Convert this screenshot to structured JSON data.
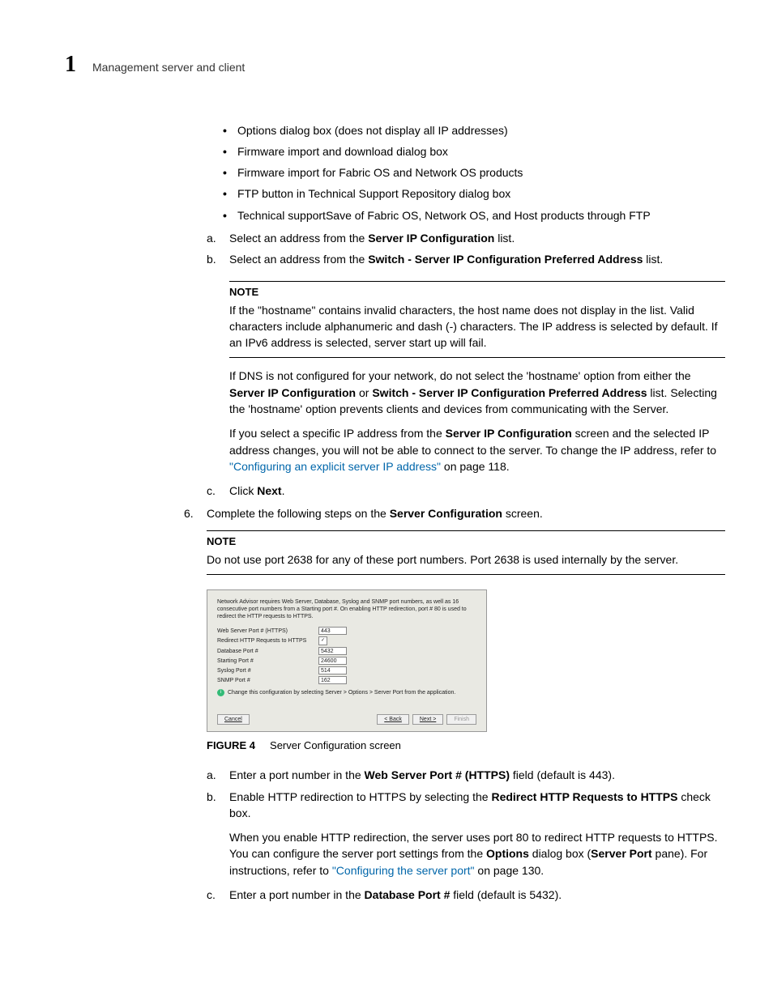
{
  "header": {
    "chapterNumber": "1",
    "chapterTitle": "Management server and client"
  },
  "bullets": [
    "Options dialog box (does not display all IP addresses)",
    "Firmware import and download dialog box",
    "Firmware import for Fabric OS and Network OS products",
    "FTP button in Technical Support Repository dialog box",
    "Technical supportSave of Fabric OS, Network OS, and Host products through FTP"
  ],
  "steps": {
    "a": {
      "pre": "Select an address from the ",
      "bold": "Server IP Configuration",
      "post": " list."
    },
    "b": {
      "pre": "Select an address from the ",
      "bold": "Switch - Server IP Configuration Preferred Address",
      "post": " list."
    },
    "c": {
      "pre": "Click ",
      "bold": "Next",
      "post": "."
    }
  },
  "note1": {
    "label": "NOTE",
    "text": "If the \"hostname\" contains invalid characters, the host name does not display in the list. Valid characters include alphanumeric and dash (-) characters. The IP address is selected by default. If an IPv6 address is selected, server start up will fail."
  },
  "dnsPara": {
    "pre": "If DNS is not configured for your network, do not select the 'hostname' option from either the ",
    "b1": "Server IP Configuration",
    "mid": " or ",
    "b2": "Switch - Server IP Configuration Preferred Address",
    "post": " list. Selecting the 'hostname' option prevents clients and devices from communicating with the Server."
  },
  "ipPara": {
    "pre": "If you select a specific IP address from the ",
    "b1": "Server IP Configuration",
    "mid": " screen and the selected IP address changes, you will not be able to connect to the server. To change the IP address, refer to ",
    "link": "\"Configuring an explicit server IP address\"",
    "post": " on page 118."
  },
  "step6": {
    "pre": "Complete the following steps on the ",
    "bold": "Server Configuration",
    "post": " screen."
  },
  "note2": {
    "label": "NOTE",
    "text": "Do not use port 2638 for any of these port numbers. Port 2638 is used internally by the server."
  },
  "figure": {
    "desc": "Network Advisor requires Web Server, Database, Syslog and SNMP port numbers, as well as 16 consecutive port numbers from a Starting port #. On enabling HTTP redirection, port # 80 is used to redirect the HTTP requests to HTTPS.",
    "rows": {
      "webServer": {
        "label": "Web Server Port # (HTTPS)",
        "value": "443"
      },
      "redirect": {
        "label": "Redirect HTTP Requests to HTTPS",
        "checked": "✓"
      },
      "db": {
        "label": "Database Port #",
        "value": "5432"
      },
      "starting": {
        "label": "Starting Port #",
        "value": "24600"
      },
      "syslog": {
        "label": "Syslog Port #",
        "value": "514"
      },
      "snmp": {
        "label": "SNMP Port #",
        "value": "162"
      }
    },
    "info": "Change this configuration by selecting Server > Options > Server Port from the application.",
    "buttons": {
      "cancel": "Cancel",
      "back": "< Back",
      "next": "Next >",
      "finish": "Finish"
    },
    "captionLabel": "FIGURE 4",
    "captionText": "Server Configuration screen"
  },
  "subSteps": {
    "a": {
      "pre": "Enter a port number in the ",
      "bold": "Web Server Port # (HTTPS)",
      "post": " field (default is 443)."
    },
    "b": {
      "pre": "Enable HTTP redirection to HTTPS by selecting the ",
      "bold": "Redirect HTTP Requests to HTTPS",
      "post": " check box."
    },
    "bPara": {
      "pre": "When you enable HTTP redirection, the server uses port 80 to redirect HTTP requests to HTTPS. You can configure the server port settings from the ",
      "b1": "Options",
      "mid": " dialog box (",
      "b2": "Server Port",
      "post1": " pane). For instructions, refer to ",
      "link": "\"Configuring the server port\"",
      "post2": " on page 130."
    },
    "c": {
      "pre": "Enter a port number in the ",
      "bold": "Database Port #",
      "post": " field (default is 5432)."
    }
  }
}
